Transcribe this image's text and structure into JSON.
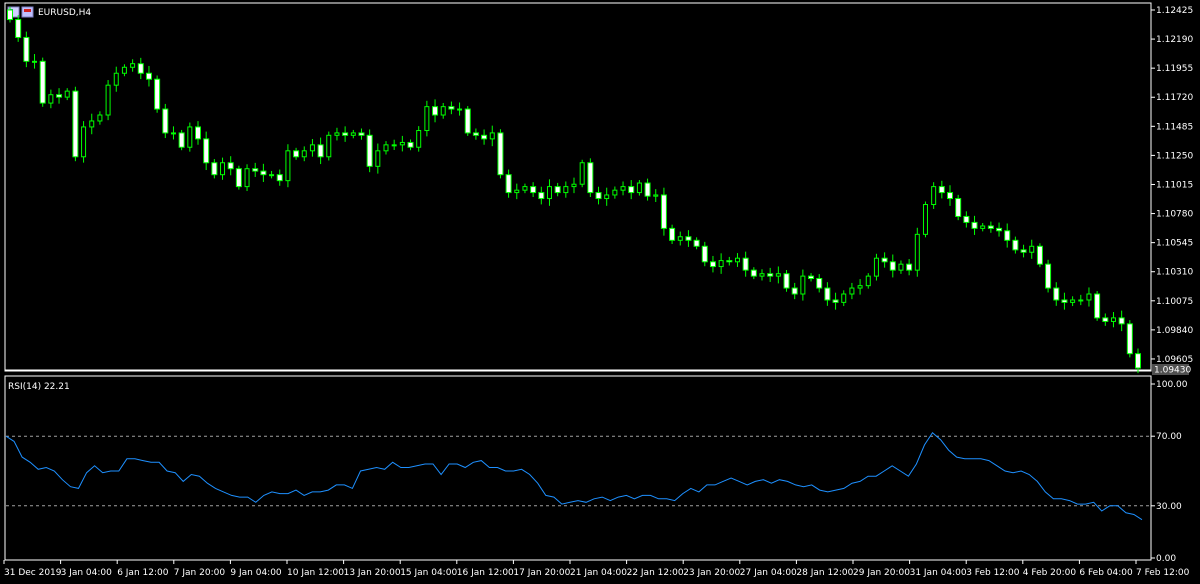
{
  "window": {
    "symbol_label": "EURUSD,H4"
  },
  "colors": {
    "background": "#000000",
    "candle": "#00ff00",
    "rsi_line": "#1e90ff",
    "axis": "#ffffff",
    "level_line": "#a0a0a0"
  },
  "icons": [
    "chart-flag-icon",
    "chart-flag-icon-2"
  ],
  "chart_data": [
    {
      "type": "candlestick",
      "title": "EURUSD,H4",
      "current_price_label": "1.09430",
      "y_ticks": [
        "1.12425",
        "1.12190",
        "1.11955",
        "1.11720",
        "1.11485",
        "1.11250",
        "1.11015",
        "1.10780",
        "1.10545",
        "1.10310",
        "1.10075",
        "1.09840",
        "1.09605"
      ],
      "ylim": [
        1.0943,
        1.1243
      ],
      "x_ticks": [
        "31 Dec 2019",
        "3 Jan 04:00",
        "6 Jan 12:00",
        "7 Jan 20:00",
        "9 Jan 04:00",
        "10 Jan 12:00",
        "13 Jan 20:00",
        "15 Jan 04:00",
        "16 Jan 12:00",
        "17 Jan 20:00",
        "21 Jan 04:00",
        "22 Jan 12:00",
        "23 Jan 20:00",
        "27 Jan 04:00",
        "28 Jan 12:00",
        "29 Jan 20:00",
        "31 Jan 04:00",
        "3 Feb 12:00",
        "4 Feb 20:00",
        "6 Feb 04:00",
        "7 Feb 12:00"
      ],
      "closes": [
        1.1235,
        1.122,
        1.12,
        1.12,
        1.1165,
        1.1172,
        1.117,
        1.1175,
        1.112,
        1.1145,
        1.115,
        1.1155,
        1.118,
        1.119,
        1.1195,
        1.1198,
        1.119,
        1.1185,
        1.116,
        1.114,
        1.114,
        1.1128,
        1.1145,
        1.1135,
        1.1115,
        1.1105,
        1.1115,
        1.111,
        1.1095,
        1.111,
        1.1108,
        1.1105,
        1.1105,
        1.11,
        1.1125,
        1.112,
        1.1125,
        1.113,
        1.112,
        1.1138,
        1.114,
        1.1138,
        1.114,
        1.1138,
        1.1112,
        1.1125,
        1.113,
        1.113,
        1.1132,
        1.1128,
        1.1142,
        1.1162,
        1.1155,
        1.1162,
        1.116,
        1.116,
        1.114,
        1.1138,
        1.1135,
        1.114,
        1.1105,
        1.109,
        1.1092,
        1.1095,
        1.109,
        1.1085,
        1.1095,
        1.109,
        1.1095,
        1.1097,
        1.1115,
        1.109,
        1.1085,
        1.1088,
        1.1092,
        1.1095,
        1.109,
        1.1098,
        1.1087,
        1.1088,
        1.106,
        1.105,
        1.1053,
        1.105,
        1.1045,
        1.1032,
        1.1028,
        1.1033,
        1.1032,
        1.1035,
        1.1025,
        1.102,
        1.1022,
        1.102,
        1.1022,
        1.101,
        1.1005,
        1.102,
        1.1018,
        1.101,
        1.1,
        1.0998,
        1.1005,
        1.101,
        1.1012,
        1.102,
        1.1035,
        1.1032,
        1.1025,
        1.103,
        1.1025,
        1.1055,
        1.108,
        1.1095,
        1.109,
        1.1085,
        1.107,
        1.1065,
        1.106,
        1.1062,
        1.106,
        1.1058,
        1.105,
        1.1042,
        1.104,
        1.1045,
        1.103,
        1.101,
        1.1,
        1.0998,
        1.1,
        1.1,
        1.1005,
        1.0985,
        1.0982,
        1.0985,
        1.098,
        1.0955,
        1.0943
      ]
    },
    {
      "type": "line",
      "title": "RSI(14) 22.21",
      "y_ticks": [
        "100.00",
        "70.00",
        "30.00",
        "0.00"
      ],
      "ylim": [
        0,
        100
      ],
      "levels": [
        70,
        30
      ],
      "values": [
        70,
        67,
        58,
        55,
        51,
        52,
        50,
        45,
        41,
        40,
        49,
        53,
        49,
        50,
        50,
        57,
        57,
        56,
        55,
        55,
        50,
        49,
        44,
        48,
        47,
        43,
        40,
        38,
        36,
        35,
        35,
        32,
        36,
        38,
        37,
        37,
        39,
        36,
        38,
        38,
        39,
        42,
        42,
        40,
        50,
        51,
        52,
        51,
        55,
        52,
        52,
        53,
        54,
        54,
        48,
        54,
        54,
        52,
        55,
        56,
        52,
        52,
        50,
        50,
        51,
        48,
        43,
        36,
        35,
        31,
        32,
        33,
        32,
        34,
        35,
        33,
        35,
        36,
        34,
        36,
        36,
        34,
        34,
        33,
        37,
        40,
        38,
        42,
        42,
        44,
        46,
        44,
        42,
        44,
        45,
        43,
        45,
        44,
        42,
        41,
        42,
        39,
        38,
        39,
        40,
        43,
        44,
        47,
        47,
        50,
        53,
        50,
        47,
        54,
        65,
        72,
        68,
        62,
        58,
        57,
        57,
        57,
        56,
        53,
        50,
        49,
        50,
        48,
        44,
        38,
        34,
        34,
        33,
        31,
        31,
        32,
        27,
        30,
        30,
        26,
        25,
        22
      ]
    }
  ]
}
